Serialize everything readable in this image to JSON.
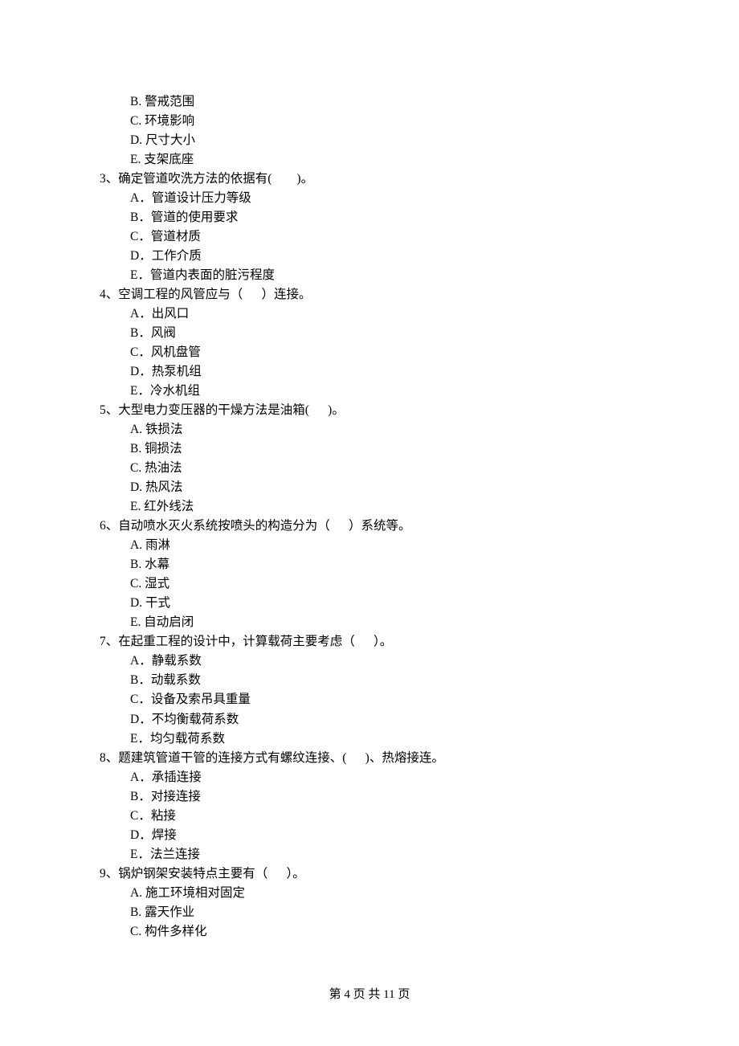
{
  "orphanOptions": [
    "B. 警戒范围",
    "C. 环境影响",
    "D. 尺寸大小",
    "E. 支架底座"
  ],
  "questions": [
    {
      "num": "3、",
      "stem": "确定管道吹洗方法的依据有(        )。",
      "options": [
        "A．管道设计压力等级",
        "B．管道的使用要求",
        "C．管道材质",
        "D．工作介质",
        "E．管道内表面的脏污程度"
      ]
    },
    {
      "num": "4、",
      "stem": "空调工程的风管应与（      ）连接。",
      "options": [
        "A．出风口",
        "B．风阀",
        "C．风机盘管",
        "D．热泵机组",
        "E．冷水机组"
      ]
    },
    {
      "num": "5、",
      "stem": "大型电力变压器的干燥方法是油箱(      )。",
      "options": [
        "A. 铁损法",
        "B. 铜损法",
        "C. 热油法",
        "D. 热风法",
        "E. 红外线法"
      ]
    },
    {
      "num": "6、",
      "stem": "自动喷水灭火系统按喷头的构造分为（      ）系统等。",
      "options": [
        "A. 雨淋",
        "B. 水幕",
        "C. 湿式",
        "D. 干式",
        "E. 自动启闭"
      ]
    },
    {
      "num": "7、",
      "stem": "在起重工程的设计中，计算载荷主要考虑（      ）。",
      "options": [
        "A．静载系数",
        "B．动载系数",
        "C．设备及索吊具重量",
        "D．不均衡载荷系数",
        "E．均匀载荷系数"
      ]
    },
    {
      "num": "8、",
      "stem": "题建筑管道干管的连接方式有螺纹连接、(      )、热熔接连。",
      "options": [
        "A．承插连接",
        "B．对接连接",
        "C．粘接",
        "D．焊接",
        "E．法兰连接"
      ]
    },
    {
      "num": "9、",
      "stem": "锅炉钢架安装特点主要有（      ）。",
      "options": [
        "A. 施工环境相对固定",
        "B. 露天作业",
        "C. 构件多样化"
      ]
    }
  ],
  "footer": "第 4 页 共 11 页"
}
